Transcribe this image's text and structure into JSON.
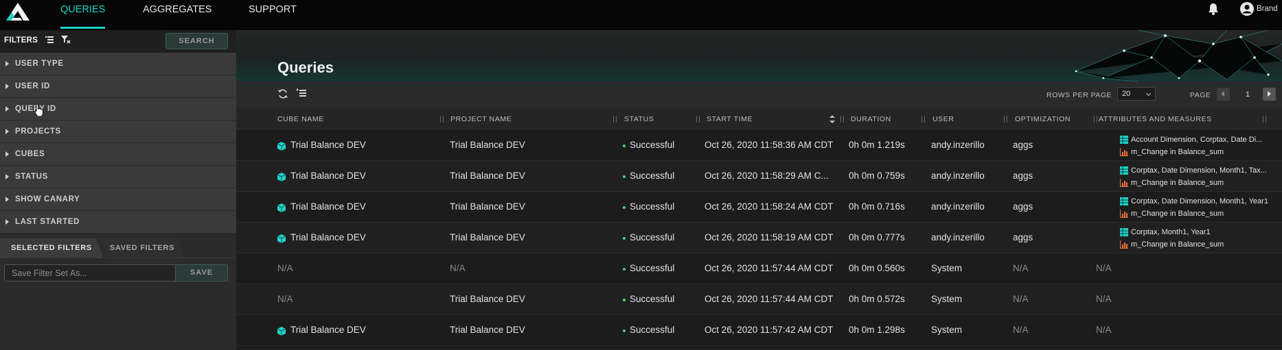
{
  "nav": {
    "items": [
      "QUERIES",
      "AGGREGATES",
      "SUPPORT"
    ],
    "active": "QUERIES",
    "user_name": "Brand"
  },
  "sidebar": {
    "filters_title": "FILTERS",
    "search_label": "SEARCH",
    "groups": [
      "USER TYPE",
      "USER ID",
      "QUERY ID",
      "PROJECTS",
      "CUBES",
      "STATUS",
      "SHOW CANARY",
      "LAST STARTED"
    ],
    "tabs": [
      "SELECTED FILTERS",
      "SAVED FILTERS"
    ],
    "save_placeholder": "Save Filter Set As...",
    "save_label": "SAVE"
  },
  "main": {
    "title": "Queries",
    "rows_per_page_label": "ROWS PER PAGE",
    "rows_per_page": "20",
    "page_label": "PAGE",
    "page": "1",
    "columns": [
      "CUBE NAME",
      "PROJECT NAME",
      "STATUS",
      "START TIME",
      "DURATION",
      "USER",
      "OPTIMIZATION",
      "ATTRIBUTES AND MEASURES"
    ],
    "rows": [
      {
        "cube": "Trial Balance DEV",
        "project": "Trial Balance DEV",
        "status": "Successful",
        "start": "Oct 26, 2020 11:58:36 AM CDT",
        "duration": "0h 0m 1.219s",
        "user": "andy.inzerillo",
        "optimization": "aggs",
        "attributes": "Account Dimension, Corptax, Date Di...",
        "measures": "m_Change in Balance_sum"
      },
      {
        "cube": "Trial Balance DEV",
        "project": "Trial Balance DEV",
        "status": "Successful",
        "start": "Oct 26, 2020 11:58:29 AM C...",
        "duration": "0h 0m 0.759s",
        "user": "andy.inzerillo",
        "optimization": "aggs",
        "attributes": "Corptax, Date Dimension, Month1, Tax...",
        "measures": "m_Change in Balance_sum"
      },
      {
        "cube": "Trial Balance DEV",
        "project": "Trial Balance DEV",
        "status": "Successful",
        "start": "Oct 26, 2020 11:58:24 AM CDT",
        "duration": "0h 0m 0.716s",
        "user": "andy.inzerillo",
        "optimization": "aggs",
        "attributes": "Corptax, Date Dimension, Month1, Year1",
        "measures": "m_Change in Balance_sum"
      },
      {
        "cube": "Trial Balance DEV",
        "project": "Trial Balance DEV",
        "status": "Successful",
        "start": "Oct 26, 2020 11:58:19 AM CDT",
        "duration": "0h 0m 0.777s",
        "user": "andy.inzerillo",
        "optimization": "aggs",
        "attributes": "Corptax, Month1, Year1",
        "measures": "m_Change in Balance_sum"
      },
      {
        "cube": "N/A",
        "project": "N/A",
        "status": "Successful",
        "start": "Oct 26, 2020 11:57:44 AM CDT",
        "duration": "0h 0m 0.560s",
        "user": "System",
        "optimization": "N/A",
        "attributes": "N/A",
        "measures": ""
      },
      {
        "cube": "N/A",
        "project": "Trial Balance DEV",
        "status": "Successful",
        "start": "Oct 26, 2020 11:57:44 AM CDT",
        "duration": "0h 0m 0.572s",
        "user": "System",
        "optimization": "N/A",
        "attributes": "N/A",
        "measures": ""
      },
      {
        "cube": "Trial Balance DEV",
        "project": "Trial Balance DEV",
        "status": "Successful",
        "start": "Oct 26, 2020 11:57:42 AM CDT",
        "duration": "0h 0m 1.298s",
        "user": "System",
        "optimization": "N/A",
        "attributes": "N/A",
        "measures": ""
      }
    ]
  },
  "icons": {
    "logo": "logo-icon",
    "bell": "bell-icon",
    "user": "user-avatar-icon",
    "filter_list": "list-icon",
    "clear_filter": "filter-clear-icon",
    "refresh": "refresh-icon",
    "columns": "column-list-icon",
    "cube": "cube-icon",
    "attributes": "table-icon",
    "measures": "bar-chart-icon",
    "collapse": "chevron-left-icon",
    "sort": "sort-icon"
  },
  "colors": {
    "accent": "#1fd3c6",
    "success": "#4cd964",
    "measure": "#e8733a",
    "background": "#1c1c1c",
    "sidebar": "#3a3a3a"
  }
}
